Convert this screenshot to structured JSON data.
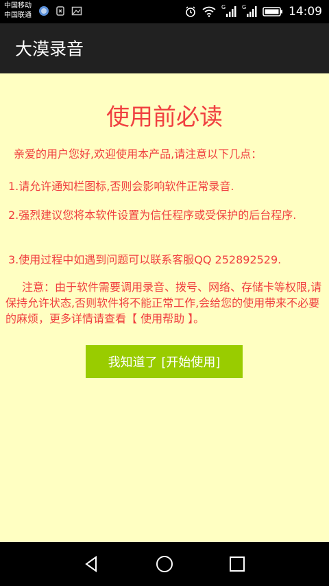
{
  "status_bar": {
    "carrier_1": "中国移动",
    "carrier_2": "中国联通",
    "signal_label_1": "G",
    "signal_label_2": "G",
    "time": "14:09",
    "icons": [
      "message-icon",
      "usb-debug-icon",
      "image-icon",
      "alarm-icon",
      "wifi-icon",
      "signal-icon",
      "battery-icon"
    ]
  },
  "app_bar": {
    "title": "大漠录音"
  },
  "notice": {
    "heading": "使用前必读",
    "intro": "亲爱的用户您好,欢迎使用本产品,请注意以下几点：",
    "item_1": "1.请允许通知栏图标,否则会影响软件正常录音.",
    "item_2": "2.强烈建议您将本软件设置为信任程序或受保护的后台程序.",
    "item_3": "3.使用过程中如遇到问题可以联系客服QQ 252892529.",
    "caution": "注意：由于软件需要调用录音、拨号、网络、存储卡等权限,请保持允许状态,否则软件将不能正常工作,会给您的使用带来不必要的麻烦，更多详情请查看【 使用帮助 】。",
    "button_label": "我知道了 [开始使用]"
  },
  "nav_bar": {
    "icons": [
      "back-icon",
      "home-icon",
      "recents-icon"
    ]
  },
  "colors": {
    "background": "#ffffc2",
    "text_accent": "#f04040",
    "button": "#99cc00",
    "app_bar": "#212121"
  }
}
